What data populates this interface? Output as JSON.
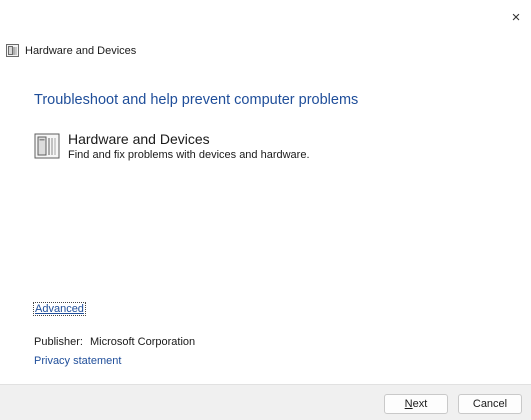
{
  "window": {
    "title": "Hardware and Devices",
    "title_icon": "troubleshooter-icon",
    "close_label": "×"
  },
  "main": {
    "heading": "Troubleshoot and help prevent computer problems",
    "item": {
      "icon": "hardware-device-icon",
      "title": "Hardware and Devices",
      "description": "Find and fix problems with devices and hardware."
    },
    "advanced_label": "Advanced",
    "publisher_label": "Publisher:",
    "publisher_value": "Microsoft Corporation",
    "privacy_label": "Privacy statement"
  },
  "footer": {
    "next_first_letter": "N",
    "next_rest": "ext",
    "cancel_label": "Cancel"
  },
  "colors": {
    "link": "#1f4e9a",
    "footer_bg": "#f0f0f0"
  }
}
